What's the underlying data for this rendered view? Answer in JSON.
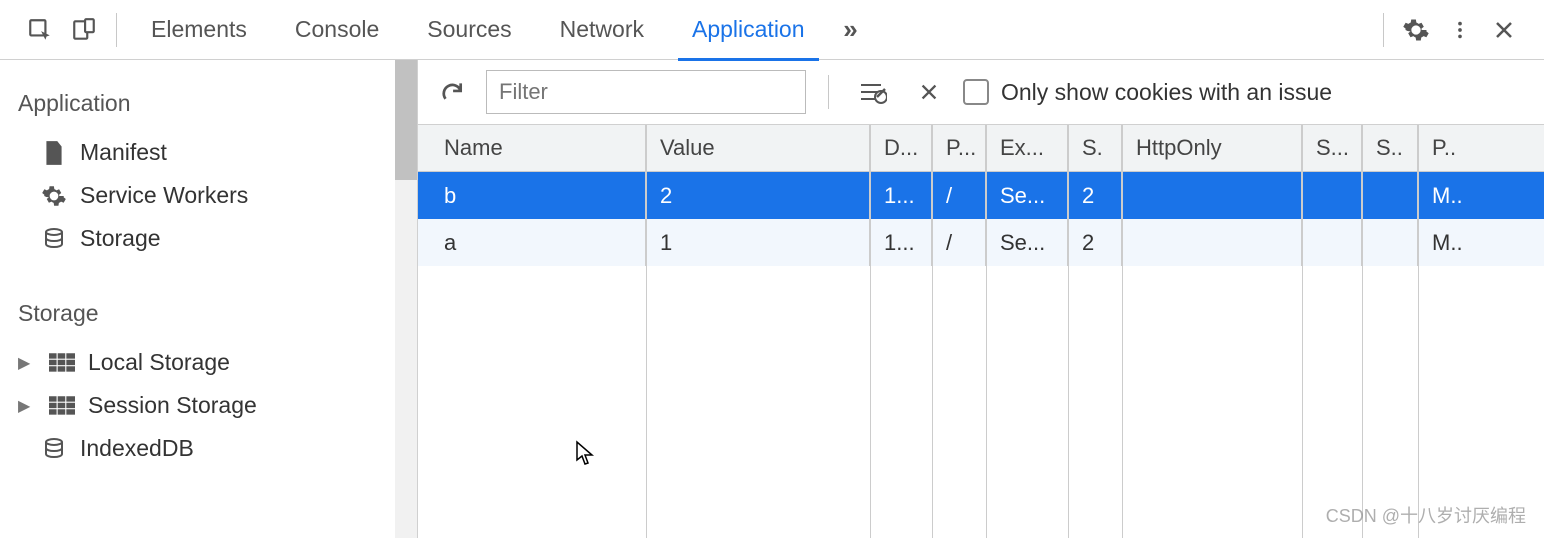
{
  "tabs": {
    "elements": "Elements",
    "console": "Console",
    "sources": "Sources",
    "network": "Network",
    "application": "Application"
  },
  "sidebar": {
    "application": {
      "title": "Application",
      "manifest": "Manifest",
      "service_workers": "Service Workers",
      "storage": "Storage"
    },
    "storage": {
      "title": "Storage",
      "local": "Local Storage",
      "session": "Session Storage",
      "indexed": "IndexedDB"
    }
  },
  "toolbar": {
    "filter_placeholder": "Filter",
    "only_issue_label": "Only show cookies with an issue"
  },
  "table": {
    "headers": {
      "name": "Name",
      "value": "Value",
      "domain": "D...",
      "path": "P...",
      "expires": "Ex...",
      "size": "S.",
      "http_only": "HttpOnly",
      "secure": "S...",
      "samesite": "S..",
      "priority": "P.."
    },
    "rows": [
      {
        "name": "b",
        "value": "2",
        "domain": "1...",
        "path": "/",
        "expires": "Se...",
        "size": "2",
        "http_only": "",
        "secure": "",
        "samesite": "",
        "priority": "M.."
      },
      {
        "name": "a",
        "value": "1",
        "domain": "1...",
        "path": "/",
        "expires": "Se...",
        "size": "2",
        "http_only": "",
        "secure": "",
        "samesite": "",
        "priority": "M.."
      }
    ]
  },
  "watermark": "CSDN @十八岁讨厌编程"
}
